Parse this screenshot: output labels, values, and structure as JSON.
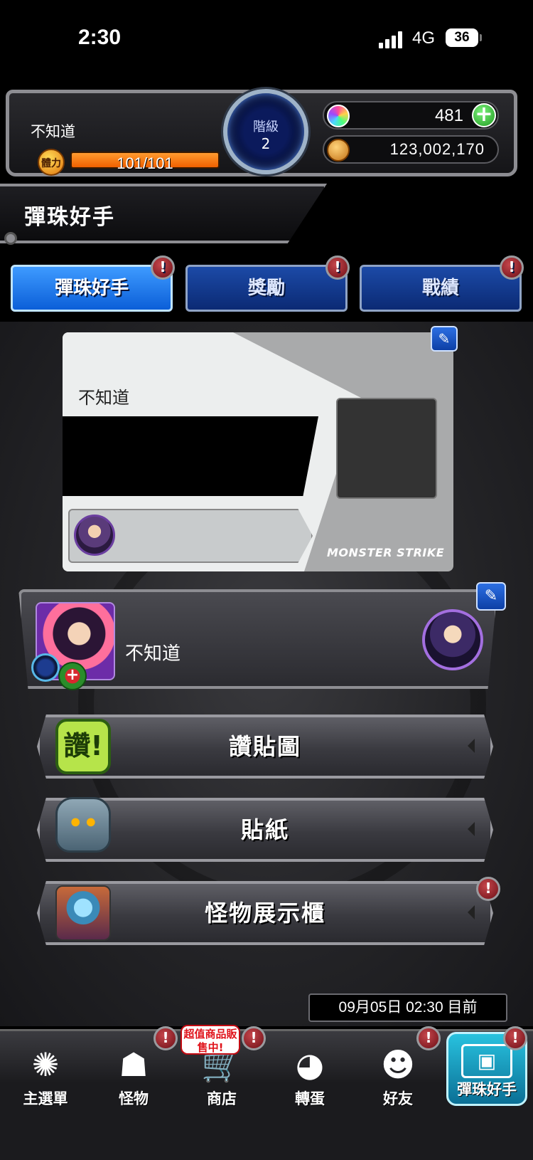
{
  "status_bar": {
    "time": "2:30",
    "network": "4G",
    "battery": "36"
  },
  "player": {
    "name": "不知道",
    "stamina_label": "體力",
    "stamina": "101/101",
    "stamina_fraction": 1.0,
    "rank_label": "階級",
    "rank_value": "2",
    "gems": "481",
    "gold": "123,002,170"
  },
  "page": {
    "title": "彈珠好手"
  },
  "tabs": [
    {
      "label": "彈珠好手",
      "active": true,
      "alert": "!"
    },
    {
      "label": "獎勵",
      "active": false,
      "alert": "!"
    },
    {
      "label": "戰績",
      "active": false,
      "alert": "!"
    }
  ],
  "card": {
    "name": "不知道",
    "brand": "MONSTER STRIKE"
  },
  "player_row": {
    "name": "不知道"
  },
  "menu": [
    {
      "label": "讚貼圖",
      "icon": "like-badge-icon",
      "icon_text": "讚!"
    },
    {
      "label": "貼紙",
      "icon": "dragon-sticker-icon"
    },
    {
      "label": "怪物展示櫃",
      "icon": "monster-display-icon",
      "alert": "!"
    }
  ],
  "timestamp": "09月05日 02:30 目前",
  "nav": [
    {
      "label": "主選單",
      "icon": "main-menu-icon",
      "glyph": "✺"
    },
    {
      "label": "怪物",
      "icon": "monster-icon",
      "glyph": "☗",
      "alert": "!"
    },
    {
      "label": "商店",
      "icon": "cart-icon",
      "glyph": "🛒",
      "alert": "!",
      "promo": "超值商品販售中!"
    },
    {
      "label": "轉蛋",
      "icon": "egg-icon",
      "glyph": "◕"
    },
    {
      "label": "好友",
      "icon": "friends-icon",
      "glyph": "☻",
      "alert": "!"
    },
    {
      "label": "彈珠好手",
      "icon": "player-card-icon",
      "glyph": "▣",
      "active": true,
      "alert": "!"
    }
  ],
  "colors": {
    "tab_active": "#1e7ef0",
    "tab_inactive": "#123c94",
    "stamina": "#f57a10",
    "alert": "#a81f28",
    "nav_active": "#1aa8cc"
  },
  "icons": {
    "gem": "rainbow-gem-icon",
    "gold": "gold-coin-icon",
    "add": "plus-icon",
    "edit": "pencil-icon",
    "element": "water-element-icon",
    "arrow": "chevron-left-icon"
  }
}
